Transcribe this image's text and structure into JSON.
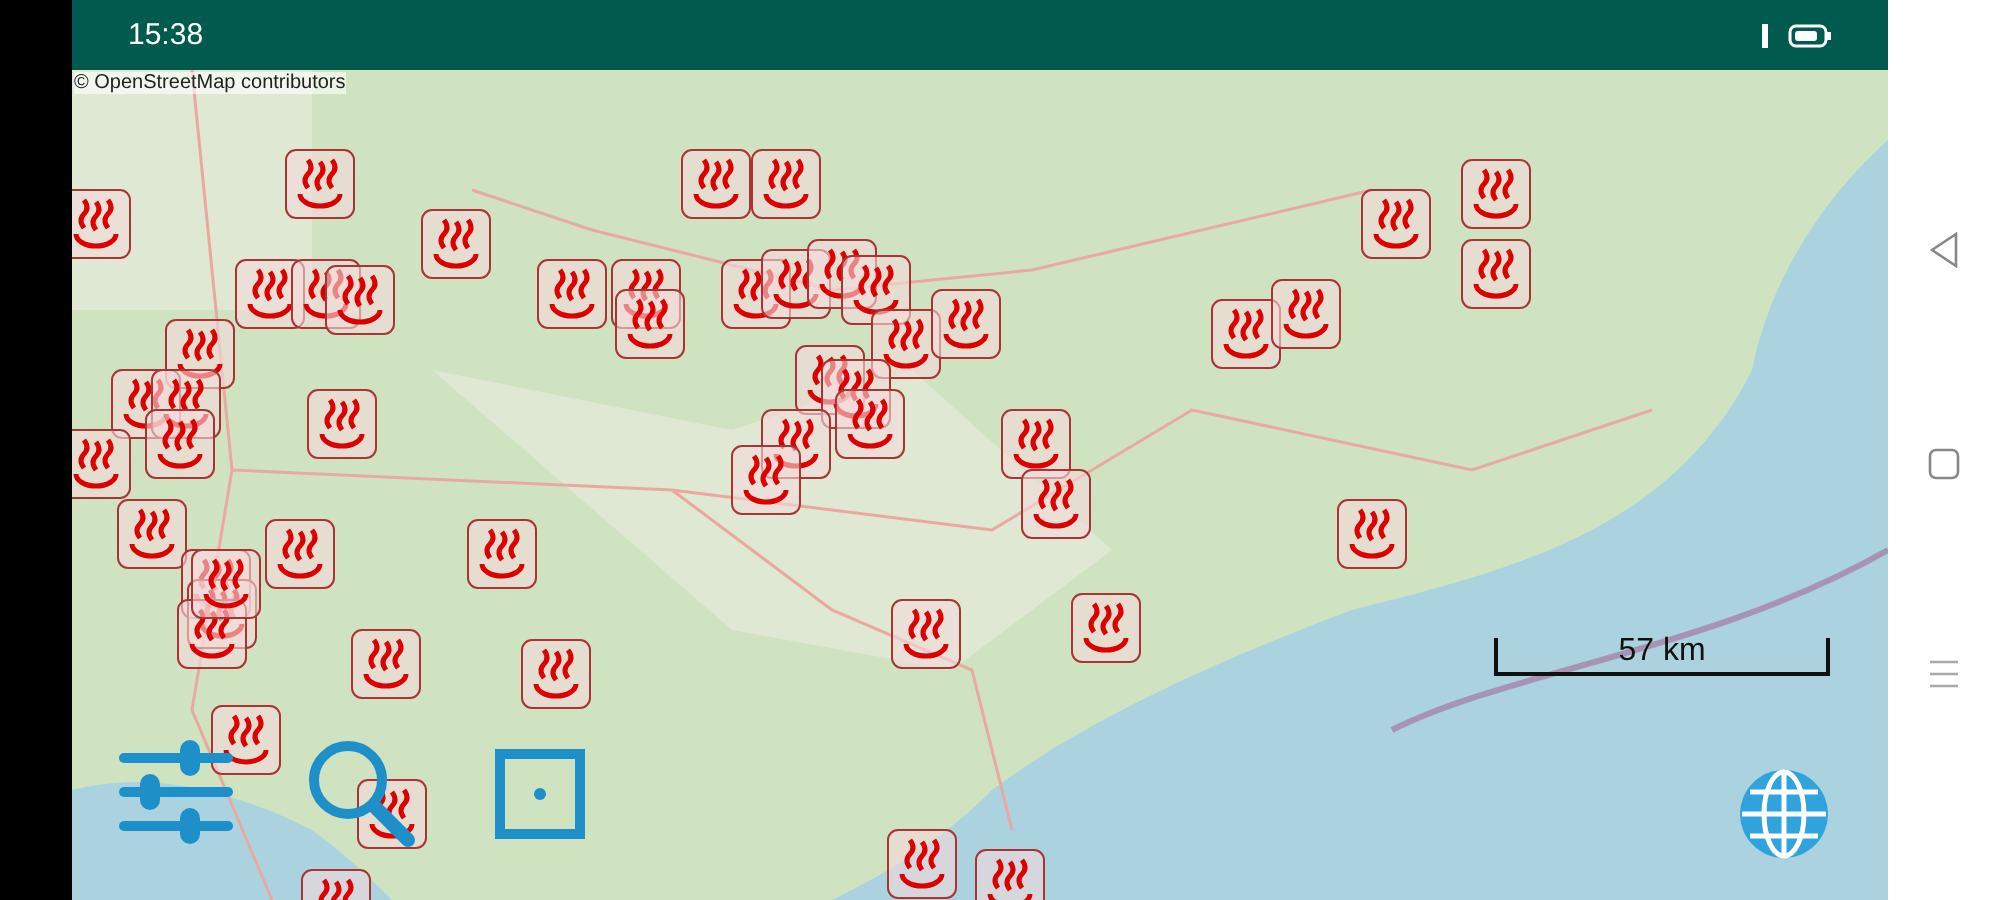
{
  "status_bar": {
    "time": "15:38"
  },
  "map": {
    "attribution": "© OpenStreetMap contributors",
    "scale_label": "57 km"
  }
}
